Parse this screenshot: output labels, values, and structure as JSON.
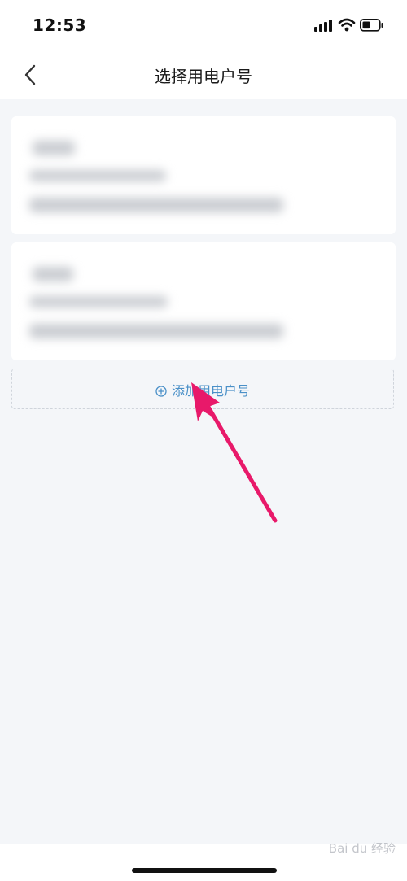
{
  "status_bar": {
    "time": "12:53"
  },
  "header": {
    "title": "选择用电户号"
  },
  "add_account": {
    "label": "添加用电户号"
  },
  "watermark": {
    "text": "Bai du 经验"
  },
  "colors": {
    "background": "#f4f6f9",
    "accent": "#4a90c8",
    "arrow": "#e8196a"
  }
}
